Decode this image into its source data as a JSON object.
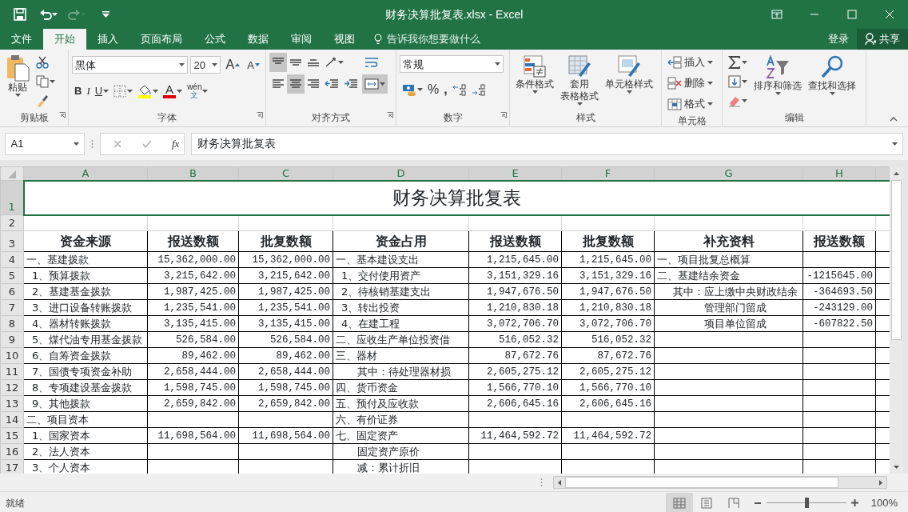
{
  "window": {
    "title": "财务决算批复表.xlsx - Excel"
  },
  "quick_access": [
    {
      "kind": "save",
      "disabled": false
    },
    {
      "kind": "undo",
      "disabled": false
    },
    {
      "kind": "redo",
      "disabled": true
    },
    {
      "kind": "customize",
      "disabled": false
    }
  ],
  "menu_tabs": [
    {
      "label": "文件",
      "selected": false
    },
    {
      "label": "开始",
      "selected": true
    },
    {
      "label": "插入",
      "selected": false
    },
    {
      "label": "页面布局",
      "selected": false
    },
    {
      "label": "公式",
      "selected": false
    },
    {
      "label": "数据",
      "selected": false
    },
    {
      "label": "审阅",
      "selected": false
    },
    {
      "label": "视图",
      "selected": false
    }
  ],
  "tell_me": "告诉我你想要做什么",
  "sign_in": "登录",
  "share": "共享",
  "ribbon": {
    "clipboard": {
      "label": "剪贴板",
      "paste": "粘贴"
    },
    "font": {
      "label": "字体",
      "font_name": "黑体",
      "font_size": "20",
      "grow": "A",
      "shrink": "A",
      "bold": "B",
      "italic": "I",
      "underline": "U",
      "font_color": "A",
      "phonetic_top": "wén",
      "phonetic_bottom": "文"
    },
    "alignment": {
      "label": "对齐方式",
      "buttons": [
        {
          "kind": "top",
          "selected": true
        },
        {
          "kind": "middle",
          "selected": false
        },
        {
          "kind": "bottom",
          "selected": false
        },
        {
          "kind": "orientation",
          "selected": false
        },
        {
          "kind": "wrap",
          "selected": false
        },
        {
          "kind": "left",
          "selected": false
        },
        {
          "kind": "center",
          "selected": true
        },
        {
          "kind": "right",
          "selected": false
        },
        {
          "kind": "outdent",
          "selected": false
        },
        {
          "kind": "indent",
          "selected": false
        },
        {
          "kind": "merge",
          "selected": true
        }
      ]
    },
    "number": {
      "label": "数字",
      "format": "常规",
      "percent": "%",
      "comma": ","
    },
    "styles": {
      "label": "样式",
      "buttons": [
        {
          "kind": "conditional",
          "lines": [
            "条件格式"
          ]
        },
        {
          "kind": "table",
          "lines": [
            "套用",
            "表格格式"
          ]
        },
        {
          "kind": "cell",
          "lines": [
            "单元格样式"
          ]
        }
      ]
    },
    "cells": {
      "label": "单元格",
      "buttons": [
        {
          "kind": "insert",
          "label": "插入"
        },
        {
          "kind": "delete",
          "label": "删除"
        },
        {
          "kind": "format",
          "label": "格式"
        }
      ]
    },
    "editing": {
      "label": "编辑",
      "buttons": [
        {
          "kind": "sort",
          "label": "排序和筛选"
        },
        {
          "kind": "find",
          "label": "查找和选择"
        }
      ]
    }
  },
  "formula_bar": {
    "name_box": "A1",
    "function_label": "fx",
    "formula": "财务决算批复表"
  },
  "sheet": {
    "columns": [
      {
        "letter": "A",
        "selected": true
      },
      {
        "letter": "B",
        "selected": true
      },
      {
        "letter": "C",
        "selected": true
      },
      {
        "letter": "D",
        "selected": true
      },
      {
        "letter": "E",
        "selected": true
      },
      {
        "letter": "F",
        "selected": true
      },
      {
        "letter": "G",
        "selected": true
      },
      {
        "letter": "H",
        "selected": true
      }
    ],
    "rows": [
      {
        "num": "1",
        "kind": "title",
        "selected": true,
        "title": "财务决算批复表"
      },
      {
        "num": "2",
        "kind": "blank",
        "selected": false
      },
      {
        "num": "3",
        "kind": "header",
        "selected": false,
        "cells": [
          "资金来源",
          "报送数额",
          "批复数额",
          "资金占用",
          "报送数额",
          "批复数额",
          "补充资料",
          "报送数额"
        ]
      },
      {
        "num": "4",
        "kind": "data",
        "selected": false,
        "cells": [
          "一、基建拨款",
          "15,362,000.00",
          "15,362,000.00",
          "一、基本建设支出",
          "1,215,645.00",
          "1,215,645.00",
          "一、项目批复总概算",
          null
        ]
      },
      {
        "num": "5",
        "kind": "data",
        "selected": false,
        "cells": [
          {
            "text": "1、预算拨款",
            "kind": "sub"
          },
          "3,215,642.00",
          "3,215,642.00",
          {
            "text": "1、交付使用资产",
            "kind": "sub"
          },
          "3,151,329.16",
          "3,151,329.16",
          "二、基建结余资金",
          "-1215645.00"
        ]
      },
      {
        "num": "6",
        "kind": "data",
        "selected": false,
        "cells": [
          {
            "text": "2、基建基金拨款",
            "kind": "sub"
          },
          "1,987,425.00",
          "1,987,425.00",
          {
            "text": "2、待核销基建支出",
            "kind": "sub"
          },
          "1,947,676.50",
          "1,947,676.50",
          {
            "text": "其中：应上缴中央财政结余",
            "kind": "sub"
          },
          "-364693.50"
        ]
      },
      {
        "num": "7",
        "kind": "data",
        "selected": false,
        "cells": [
          {
            "text": "3、进口设备转账拨款",
            "kind": "sub"
          },
          "1,235,541.00",
          "1,235,541.00",
          {
            "text": "3、转出投资",
            "kind": "sub"
          },
          "1,210,830.18",
          "1,210,830.18",
          {
            "text": "管理部门留成",
            "kind": "sub"
          },
          "-243129.00"
        ]
      },
      {
        "num": "8",
        "kind": "data",
        "selected": false,
        "cells": [
          {
            "text": "4、器材转账拨款",
            "kind": "sub"
          },
          "3,135,415.00",
          "3,135,415.00",
          {
            "text": "4、在建工程",
            "kind": "sub"
          },
          "3,072,706.70",
          "3,072,706.70",
          {
            "text": "项目单位留成",
            "kind": "sub"
          },
          "-607822.50"
        ]
      },
      {
        "num": "9",
        "kind": "data",
        "selected": false,
        "cells": [
          {
            "text": "5、煤代油专用基金拨款",
            "kind": "sub"
          },
          "526,584.00",
          "526,584.00",
          "二、应收生产单位投资借",
          "516,052.32",
          "516,052.32",
          null,
          null
        ]
      },
      {
        "num": "10",
        "kind": "data",
        "selected": false,
        "cells": [
          {
            "text": "6、自筹资金拨款",
            "kind": "sub"
          },
          "89,462.00",
          "89,462.00",
          "三、器材",
          "87,672.76",
          "87,672.76",
          null,
          null
        ]
      },
      {
        "num": "11",
        "kind": "data",
        "selected": false,
        "cells": [
          {
            "text": "7、国债专项资金补助",
            "kind": "sub"
          },
          "2,658,444.00",
          "2,658,444.00",
          {
            "text": "其中：待处理器材损",
            "kind": "deep"
          },
          "2,605,275.12",
          "2,605,275.12",
          null,
          null
        ]
      },
      {
        "num": "12",
        "kind": "data",
        "selected": false,
        "cells": [
          {
            "text": "8、专项建设基金拨款",
            "kind": "sub"
          },
          "1,598,745.00",
          "1,598,745.00",
          "四、货币资金",
          "1,566,770.10",
          "1,566,770.10",
          null,
          null
        ]
      },
      {
        "num": "13",
        "kind": "data",
        "selected": false,
        "cells": [
          {
            "text": "9、其他拨款",
            "kind": "sub"
          },
          "2,659,842.00",
          "2,659,842.00",
          "五、预付及应收款",
          "2,606,645.16",
          "2,606,645.16",
          null,
          null
        ]
      },
      {
        "num": "14",
        "kind": "data",
        "selected": false,
        "cells": [
          "二、项目资本",
          null,
          null,
          "六、有价证券",
          null,
          null,
          null,
          null
        ]
      },
      {
        "num": "15",
        "kind": "data",
        "selected": false,
        "cells": [
          {
            "text": "1、国家资本",
            "kind": "sub"
          },
          "11,698,564.00",
          "11,698,564.00",
          "七、固定资产",
          "11,464,592.72",
          "11,464,592.72",
          null,
          null
        ]
      },
      {
        "num": "16",
        "kind": "data",
        "selected": false,
        "cells": [
          {
            "text": "2、法人资本",
            "kind": "sub"
          },
          null,
          null,
          {
            "text": "固定资产原价",
            "kind": "deep"
          },
          null,
          null,
          null,
          null
        ]
      },
      {
        "num": "17",
        "kind": "data",
        "selected": false,
        "cells": [
          {
            "text": "3、个人资本",
            "kind": "sub"
          },
          null,
          null,
          {
            "text": "减：累计折旧",
            "kind": "deep"
          },
          null,
          null,
          null,
          null
        ]
      }
    ]
  },
  "status_bar": {
    "status": "就绪",
    "views": [
      {
        "kind": "normal",
        "selected": true
      },
      {
        "kind": "page_layout",
        "selected": false
      },
      {
        "kind": "page_break",
        "selected": false
      }
    ],
    "zoom_slider": {
      "level": 0.5
    },
    "zoom": "100%"
  }
}
